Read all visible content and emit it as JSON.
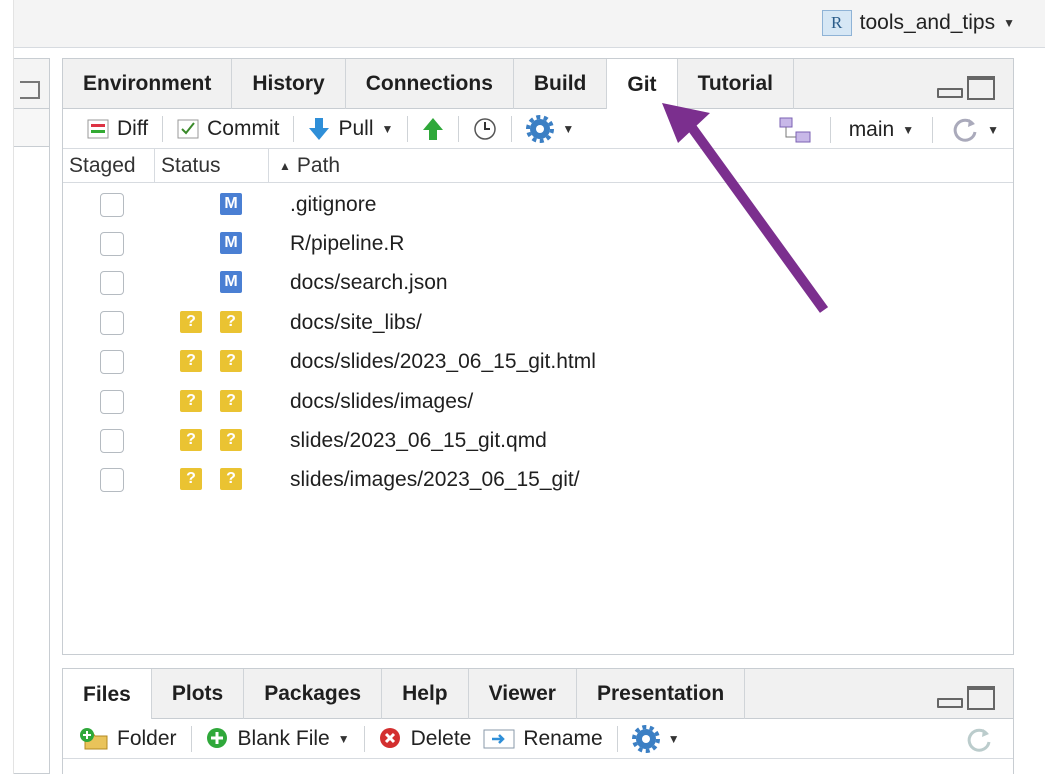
{
  "project": {
    "name": "tools_and_tips",
    "icon": "R"
  },
  "git_pane": {
    "tabs": [
      {
        "label": "Environment",
        "active": false
      },
      {
        "label": "History",
        "active": false
      },
      {
        "label": "Connections",
        "active": false
      },
      {
        "label": "Build",
        "active": false
      },
      {
        "label": "Git",
        "active": true
      },
      {
        "label": "Tutorial",
        "active": false
      }
    ],
    "toolbar": {
      "diff": "Diff",
      "commit": "Commit",
      "pull": "Pull",
      "branch": "main"
    },
    "columns": {
      "staged": "Staged",
      "status": "Status",
      "path": "Path"
    },
    "files": [
      {
        "path": ".gitignore",
        "status": [
          "M"
        ]
      },
      {
        "path": "R/pipeline.R",
        "status": [
          "M"
        ]
      },
      {
        "path": "docs/search.json",
        "status": [
          "M"
        ]
      },
      {
        "path": "docs/site_libs/",
        "status": [
          "?",
          "?"
        ]
      },
      {
        "path": "docs/slides/2023_06_15_git.html",
        "status": [
          "?",
          "?"
        ]
      },
      {
        "path": "docs/slides/images/",
        "status": [
          "?",
          "?"
        ]
      },
      {
        "path": "slides/2023_06_15_git.qmd",
        "status": [
          "?",
          "?"
        ]
      },
      {
        "path": "slides/images/2023_06_15_git/",
        "status": [
          "?",
          "?"
        ]
      }
    ]
  },
  "files_pane": {
    "tabs": [
      {
        "label": "Files",
        "active": true
      },
      {
        "label": "Plots",
        "active": false
      },
      {
        "label": "Packages",
        "active": false
      },
      {
        "label": "Help",
        "active": false
      },
      {
        "label": "Viewer",
        "active": false
      },
      {
        "label": "Presentation",
        "active": false
      }
    ],
    "toolbar": {
      "folder": "Folder",
      "blank_file": "Blank File",
      "delete": "Delete",
      "rename": "Rename"
    }
  },
  "colors": {
    "annotation_arrow": "#7b2f8e",
    "modified_badge": "#4a7fd3",
    "untracked_badge": "#eac332"
  }
}
